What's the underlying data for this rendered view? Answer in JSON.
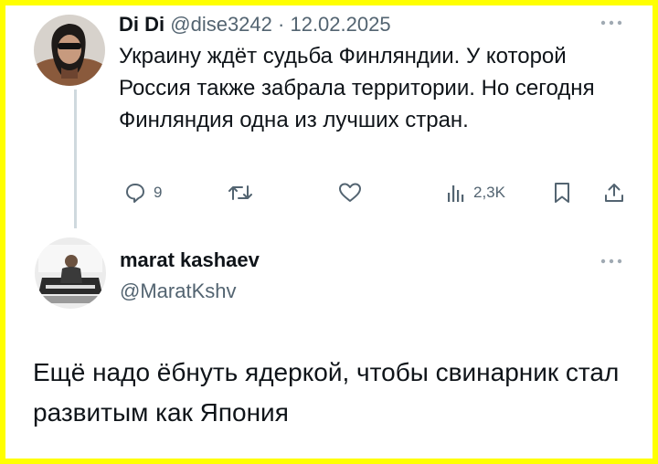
{
  "tweet1": {
    "display_name": "Di Di",
    "handle": "@dise3242",
    "separator": "·",
    "date": "12.02.2025",
    "text": "Украину ждёт судьба Финляндии. У которой Россия также забрала территории. Но сегодня Финляндия одна из лучших стран.",
    "actions": {
      "reply_count": "9",
      "views_count": "2,3K"
    }
  },
  "tweet2": {
    "display_name": "marat kashaev",
    "handle": "@MaratKshv",
    "text": "Ещё надо ёбнуть ядеркой, чтобы свинарник стал развитым как Япония"
  },
  "icons": {
    "reply": "speech-bubble",
    "retweet": "retweet-arrows",
    "like": "heart",
    "views": "bar-chart",
    "bookmark": "bookmark",
    "share": "share-upload",
    "more": "three-dots"
  },
  "colors": {
    "border": "#ffff00",
    "text": "#0f1419",
    "muted": "#536471",
    "thread_line": "#cfd9de"
  }
}
